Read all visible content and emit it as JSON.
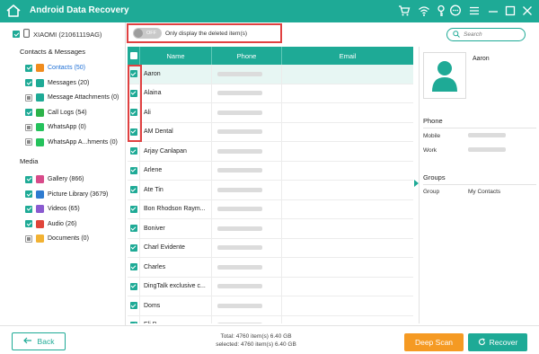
{
  "app": {
    "title": "Android Data Recovery"
  },
  "titlebar_icons": [
    "cart-icon",
    "wifi-icon",
    "key-icon",
    "chat-icon",
    "menu-icon",
    "minimize-icon",
    "close-icon"
  ],
  "device": {
    "name": "XIAOMI (21061119AG)"
  },
  "sections": {
    "contacts_messages": "Contacts & Messages",
    "media": "Media"
  },
  "categories_contacts": [
    {
      "label": "Contacts (50)",
      "state": "on",
      "color": "#f08c1e",
      "active": true
    },
    {
      "label": "Messages (20)",
      "state": "on",
      "color": "#1eaa96",
      "active": false
    },
    {
      "label": "Message Attachments (0)",
      "state": "partial",
      "color": "#1eaa96",
      "active": false
    },
    {
      "label": "Call Logs (54)",
      "state": "on",
      "color": "#2db34a",
      "active": false
    },
    {
      "label": "WhatsApp (0)",
      "state": "partial",
      "color": "#25c25c",
      "active": false
    },
    {
      "label": "WhatsApp A...hments (0)",
      "state": "partial",
      "color": "#25c25c",
      "active": false
    }
  ],
  "categories_media": [
    {
      "label": "Gallery (866)",
      "state": "on",
      "color": "#d84b8a"
    },
    {
      "label": "Picture Library (3679)",
      "state": "on",
      "color": "#2e7bd0"
    },
    {
      "label": "Videos (65)",
      "state": "on",
      "color": "#8a5bd0"
    },
    {
      "label": "Audio (26)",
      "state": "on",
      "color": "#e0453a"
    },
    {
      "label": "Documents (0)",
      "state": "partial",
      "color": "#f2b233"
    }
  ],
  "filter": {
    "toggle_state": "OFF",
    "label": "Only display the deleted item(s)"
  },
  "search": {
    "placeholder": "Search"
  },
  "table": {
    "headers": {
      "name": "Name",
      "phone": "Phone",
      "email": "Email"
    },
    "rows": [
      "Aaron",
      "Alaina",
      "Ali",
      "AM Dental",
      "Arjay Canlapan",
      "Arlene",
      "Ate Tin",
      "Bon Rhodson Raym...",
      "Boniver",
      "Charl Evidente",
      "Charles",
      "DingTalk exclusive c...",
      "Doms",
      "Eli B"
    ],
    "selected_index": 0
  },
  "details": {
    "contact_name": "Aaron",
    "phone_section": "Phone",
    "mobile_label": "Mobile",
    "work_label": "Work",
    "groups_section": "Groups",
    "group_label": "Group",
    "group_value": "My Contacts"
  },
  "footer": {
    "back": "Back",
    "total": "Total: 4760 item(s) 6.40 GB",
    "selected": "selected: 4760 item(s) 6.40 GB",
    "deep_scan": "Deep Scan",
    "recover": "Recover"
  },
  "colors": {
    "accent": "#1eaa96",
    "highlight": "#e04141",
    "deep_scan": "#f59a23"
  }
}
